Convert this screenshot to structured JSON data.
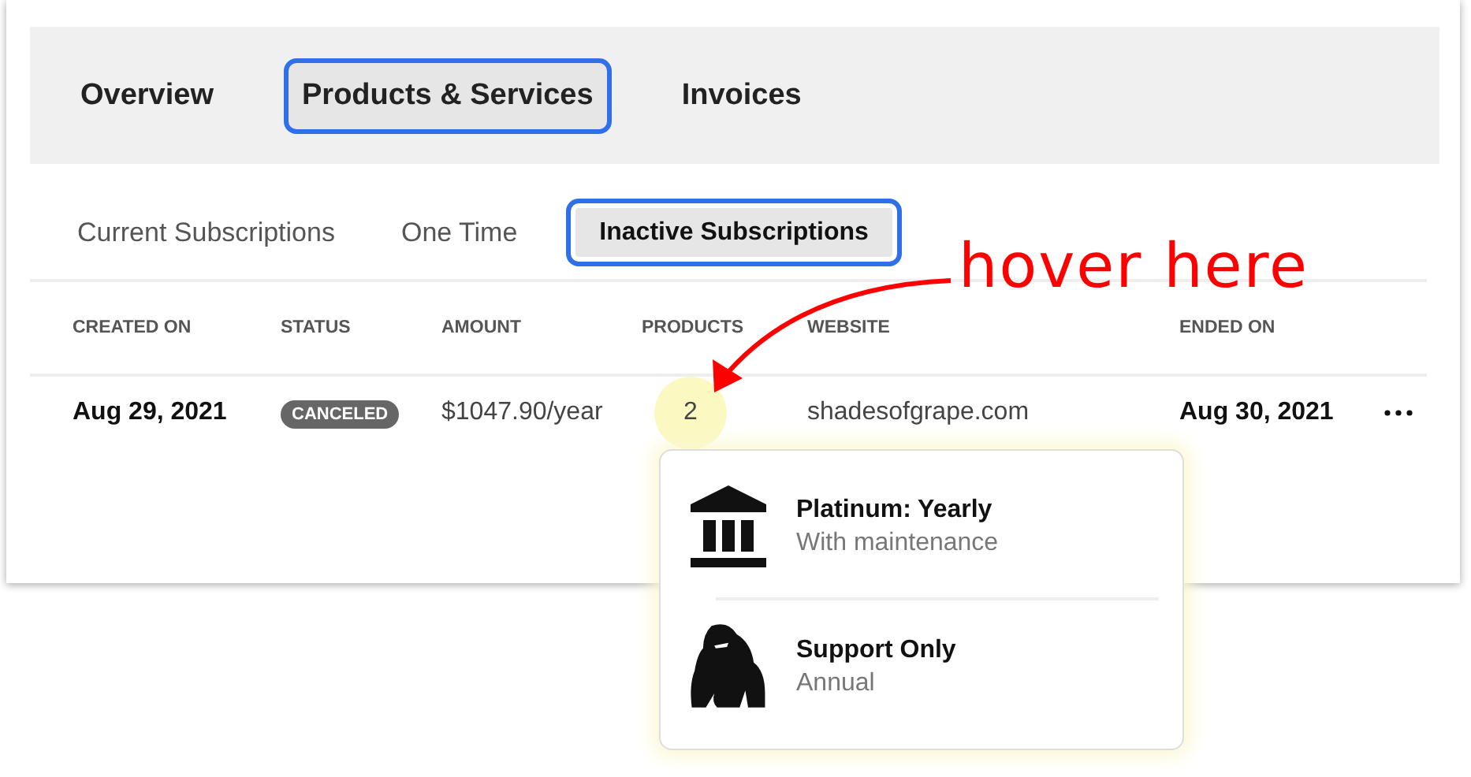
{
  "main_tabs": [
    {
      "label": "Overview",
      "selected": false
    },
    {
      "label": "Products & Services",
      "selected": true
    },
    {
      "label": "Invoices",
      "selected": false
    }
  ],
  "sub_tabs": [
    {
      "label": "Current Subscriptions",
      "selected": false
    },
    {
      "label": "One Time",
      "selected": false
    },
    {
      "label": "Inactive Subscriptions",
      "selected": true
    }
  ],
  "table": {
    "columns": [
      "CREATED ON",
      "STATUS",
      "AMOUNT",
      "PRODUCTS",
      "WEBSITE",
      "ENDED ON"
    ],
    "rows": [
      {
        "created_on": "Aug 29, 2021",
        "status": "CANCELED",
        "amount": "$1047.90/year",
        "products": "2",
        "products_hovered": true,
        "website": "shadesofgrape.com",
        "ended_on": "Aug 30, 2021"
      }
    ]
  },
  "products_popover": {
    "items": [
      {
        "kind": "bank",
        "title": "Platinum: Yearly",
        "subtitle": "With maintenance"
      },
      {
        "kind": "gorilla",
        "title": "Support Only",
        "subtitle": "Annual"
      }
    ]
  },
  "annotation": {
    "text": "hover here"
  }
}
